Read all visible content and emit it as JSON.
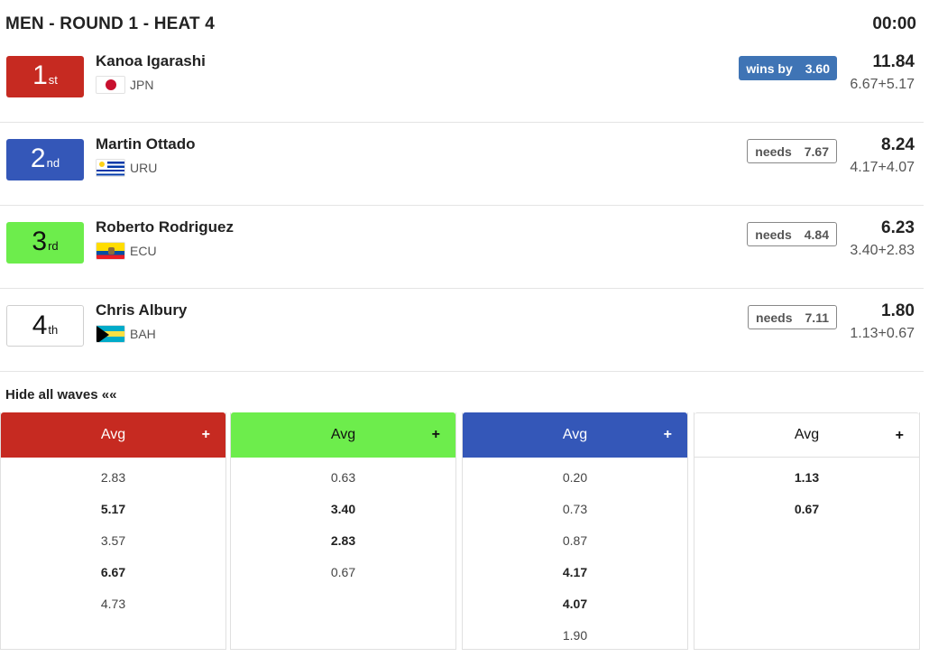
{
  "heat": {
    "title": "MEN - ROUND 1 - HEAT 4",
    "timer": "00:00"
  },
  "colors": {
    "red": "#c62a21",
    "blue": "#3457b8",
    "green": "#6ded4c",
    "wins": "#3f74b5"
  },
  "athletes": [
    {
      "place": "1",
      "suffix": "st",
      "name": "Kanoa Igarashi",
      "country": "JPN",
      "flag": "jpn-flag-icon",
      "status_label": "wins by",
      "status_value": "3.60",
      "total": "11.84",
      "breakdown": "6.67+5.17"
    },
    {
      "place": "2",
      "suffix": "nd",
      "name": "Martin Ottado",
      "country": "URU",
      "flag": "uru-flag-icon",
      "status_label": "needs",
      "status_value": "7.67",
      "total": "8.24",
      "breakdown": "4.17+4.07"
    },
    {
      "place": "3",
      "suffix": "rd",
      "name": "Roberto Rodriguez",
      "country": "ECU",
      "flag": "ecu-flag-icon",
      "status_label": "needs",
      "status_value": "4.84",
      "total": "6.23",
      "breakdown": "3.40+2.83"
    },
    {
      "place": "4",
      "suffix": "th",
      "name": "Chris Albury",
      "country": "BAH",
      "flag": "bah-flag-icon",
      "status_label": "needs",
      "status_value": "7.11",
      "total": "1.80",
      "breakdown": "1.13+0.67"
    }
  ],
  "waves": {
    "toggle_label": "Hide all waves ««",
    "columns": [
      {
        "header": "Avg",
        "plus": "+",
        "scores": [
          {
            "v": "2.83",
            "b": false
          },
          {
            "v": "5.17",
            "b": true
          },
          {
            "v": "3.57",
            "b": false
          },
          {
            "v": "6.67",
            "b": true
          },
          {
            "v": "4.73",
            "b": false
          }
        ]
      },
      {
        "header": "Avg",
        "plus": "+",
        "scores": [
          {
            "v": "0.63",
            "b": false
          },
          {
            "v": "3.40",
            "b": true
          },
          {
            "v": "2.83",
            "b": true
          },
          {
            "v": "0.67",
            "b": false
          }
        ]
      },
      {
        "header": "Avg",
        "plus": "+",
        "scores": [
          {
            "v": "0.20",
            "b": false
          },
          {
            "v": "0.73",
            "b": false
          },
          {
            "v": "0.87",
            "b": false
          },
          {
            "v": "4.17",
            "b": true
          },
          {
            "v": "4.07",
            "b": true
          },
          {
            "v": "1.90",
            "b": false
          }
        ]
      },
      {
        "header": "Avg",
        "plus": "+",
        "scores": [
          {
            "v": "1.13",
            "b": true
          },
          {
            "v": "0.67",
            "b": true
          }
        ]
      }
    ]
  }
}
